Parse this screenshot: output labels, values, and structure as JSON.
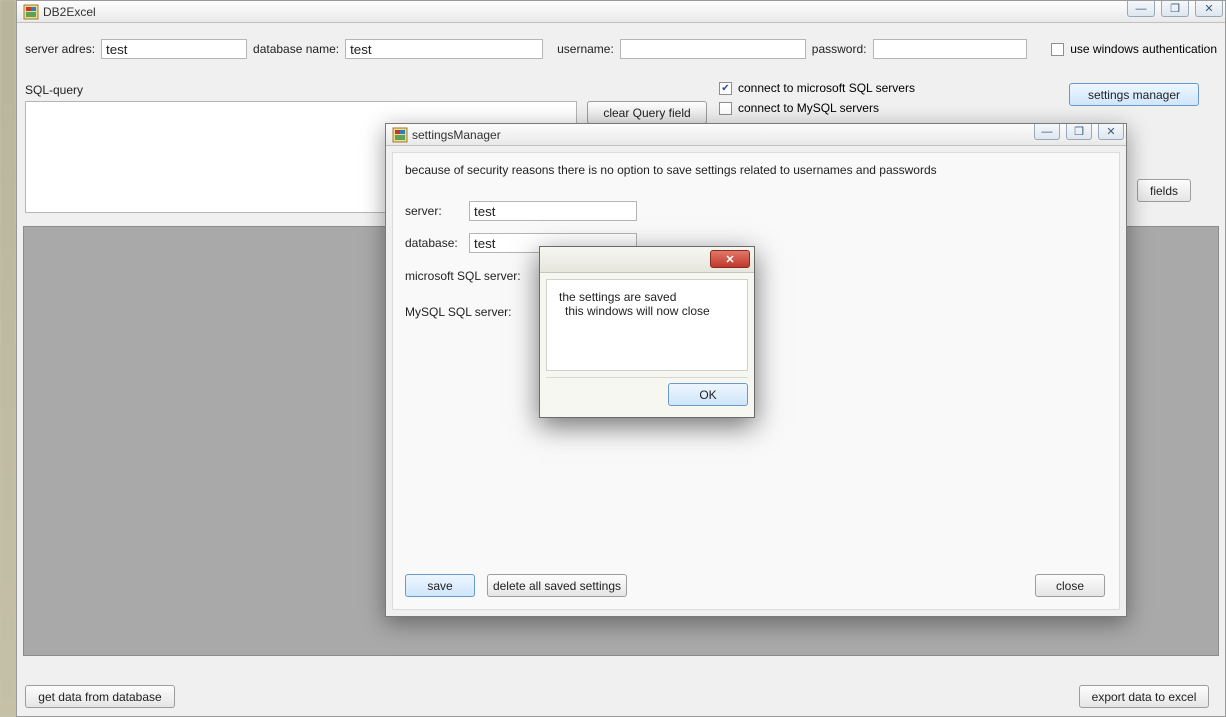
{
  "main": {
    "title": "DB2Excel",
    "labels": {
      "server_adres": "server adres:",
      "database_name": "database name:",
      "username": "username:",
      "password": "password:",
      "use_windows_auth": "use windows authentication",
      "sql_query": "SQL-query",
      "connect_mssql": "connect to microsoft SQL  servers",
      "connect_mysql": "connect to MySQL servers"
    },
    "values": {
      "server_adres": "test",
      "database_name": "test",
      "username": "",
      "password": "",
      "sql_query": "",
      "use_windows_auth_checked": false,
      "connect_mssql_checked": true,
      "connect_mysql_checked": false
    },
    "buttons": {
      "clear_query": "clear Query field",
      "settings_manager": "settings manager",
      "fields": "fields",
      "get_data": "get data from database",
      "export_excel": "export data to excel"
    },
    "window_controls": {
      "minimize": "—",
      "maximize": "❐",
      "close": "✕"
    }
  },
  "settings": {
    "title": "settingsManager",
    "note": "because of security reasons there is no option to save settings related to usernames and passwords",
    "labels": {
      "server": "server:",
      "database": "database:",
      "mssql": "microsoft SQL server:",
      "mysql": "MySQL SQL server:"
    },
    "values": {
      "server": "test",
      "database": "test",
      "mssql": "True",
      "mysql": "False"
    },
    "buttons": {
      "save": "save",
      "delete_all": "delete all saved settings",
      "close": "close"
    },
    "window_controls": {
      "minimize": "—",
      "maximize": "❐",
      "close": "✕"
    }
  },
  "msgbox": {
    "line1": "the settings are saved",
    "line2": "this windows will now close",
    "ok": "OK"
  }
}
